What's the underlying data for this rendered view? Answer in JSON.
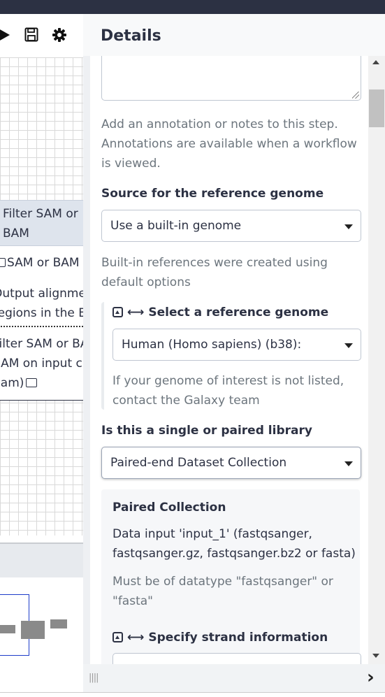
{
  "left": {
    "node": {
      "title": "Filter SAM or BAM",
      "input": "SAM or BAM",
      "output_lines": [
        "Output alignme",
        "regions in the B"
      ],
      "output2_lines": [
        "Filter SAM or BA",
        "SAM on input c",
        "bam)"
      ]
    }
  },
  "panel": {
    "title": "Details",
    "annotation_help": [
      "Add an annotation or notes to this step.",
      "Annotations are available when a workflow",
      "is viewed."
    ],
    "ref_source": {
      "label": "Source for the reference genome",
      "value": "Use a built-in genome",
      "help": [
        "Built-in references were created using",
        "default options"
      ]
    },
    "ref_genome": {
      "label": "Select a reference genome",
      "value": "Human (Homo sapiens) (b38):",
      "help": [
        "If your genome of interest is not listed,",
        "contact the Galaxy team"
      ]
    },
    "library": {
      "label": "Is this a single or paired library",
      "value": "Paired-end Dataset Collection"
    },
    "paired": {
      "title": "Paired Collection",
      "desc": [
        "Data input 'input_1' (fastqsanger,",
        "fastqsanger.gz, fastqsanger.bz2 or fasta)"
      ],
      "help": [
        "Must be of datatype \"fastqsanger\" or",
        "\"fasta\""
      ],
      "strand_label": "Specify strand information"
    }
  },
  "icons": [
    "play-icon",
    "save-icon",
    "gear-icon",
    "folder-icon",
    "collapse-icon",
    "arrows-horizontal-icon",
    "chevron-right-icon",
    "resize-grip-icon"
  ]
}
